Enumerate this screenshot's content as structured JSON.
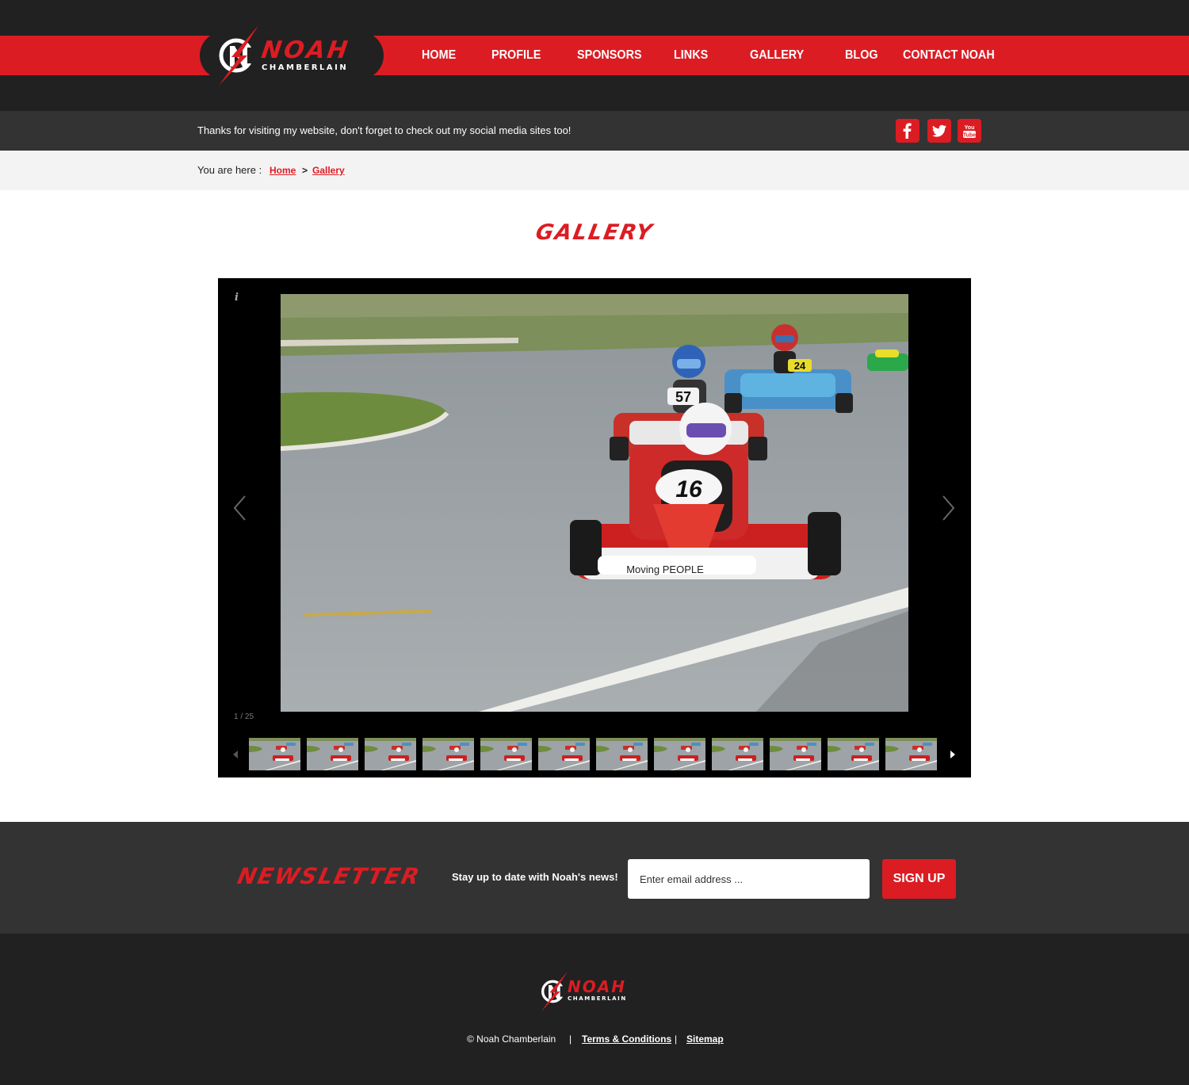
{
  "brand": {
    "name": "NOAH",
    "sub": "CHAMBERLAIN"
  },
  "nav": [
    {
      "label": "HOME"
    },
    {
      "label": "PROFILE"
    },
    {
      "label": "SPONSORS"
    },
    {
      "label": "LINKS"
    },
    {
      "label": "GALLERY"
    },
    {
      "label": "BLOG"
    },
    {
      "label": "CONTACT NOAH"
    }
  ],
  "infobar": {
    "message": "Thanks for visiting my website, don't forget to check out my social media sites too!"
  },
  "social": [
    {
      "icon": "facebook-icon"
    },
    {
      "icon": "twitter-icon"
    },
    {
      "icon": "youtube-icon",
      "text": "You Tube"
    }
  ],
  "breadcrumb": {
    "label": "You are here :",
    "home": "Home",
    "separator": ">",
    "current": "Gallery"
  },
  "page": {
    "title": "GALLERY"
  },
  "gallery": {
    "info": "i",
    "counter": "1 / 25",
    "photo_caption": "Moving PEOPLE",
    "kart_numbers": [
      "16",
      "57",
      "24"
    ],
    "thumbnail_count": 12
  },
  "newsletter": {
    "title": "NEWSLETTER",
    "text": "Stay up to date with Noah's news!",
    "placeholder": "Enter email address ...",
    "button": "SIGN UP"
  },
  "footer": {
    "copyright": "© Noah Chamberlain",
    "divider": "|",
    "terms": "Terms & Conditions",
    "sitemap": "Sitemap"
  },
  "colors": {
    "accent": "#dc1c23",
    "dark": "#212121",
    "bar": "#333333",
    "light": "#f3f3f3"
  }
}
